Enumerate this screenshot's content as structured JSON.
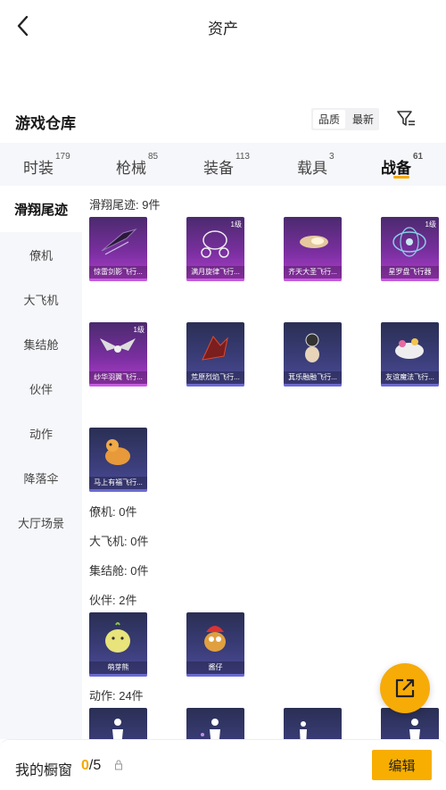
{
  "header": {
    "title": "资产"
  },
  "warehouse": {
    "title": "游戏仓库",
    "sort_options": [
      "品质",
      "最新"
    ],
    "active_sort": "品质"
  },
  "tabs": [
    {
      "label": "时装",
      "count": "179"
    },
    {
      "label": "枪械",
      "count": "85"
    },
    {
      "label": "装备",
      "count": "113"
    },
    {
      "label": "载具",
      "count": "3"
    },
    {
      "label": "战备",
      "count": "61",
      "active": true
    }
  ],
  "sidebar": {
    "items": [
      "滑翔尾迹",
      "僚机",
      "大飞机",
      "集结舱",
      "伙伴",
      "动作",
      "降落伞",
      "大厅场景"
    ],
    "active": "滑翔尾迹"
  },
  "sections": {
    "glide": {
      "label": "滑翔尾迹: 9件",
      "items": [
        {
          "name": "惊雷剑影飞行...",
          "level": "",
          "rarity": "purple"
        },
        {
          "name": "满月旋律飞行...",
          "level": "1级",
          "rarity": "purple"
        },
        {
          "name": "齐天大圣飞行...",
          "level": "",
          "rarity": "purple"
        },
        {
          "name": "星罗盘飞行器",
          "level": "1级",
          "rarity": "purple"
        },
        {
          "name": "纱华羽翼飞行...",
          "level": "1级",
          "rarity": "purple"
        },
        {
          "name": "荒原烈焰飞行...",
          "level": "",
          "rarity": "blue"
        },
        {
          "name": "萁乐融融飞行...",
          "level": "",
          "rarity": "blue"
        },
        {
          "name": "友谊魔法飞行...",
          "level": "",
          "rarity": "blue"
        },
        {
          "name": "马上有福飞行...",
          "level": "",
          "rarity": "blue"
        }
      ]
    },
    "wingman": {
      "label": "僚机: 0件"
    },
    "plane": {
      "label": "大飞机: 0件"
    },
    "pod": {
      "label": "集结舱: 0件"
    },
    "partner": {
      "label": "伙伴: 2件",
      "items": [
        {
          "name": "萌芽熊",
          "rarity": "blue"
        },
        {
          "name": "酱仔",
          "rarity": "blue"
        }
      ]
    },
    "emote": {
      "label": "动作: 24件"
    }
  },
  "bottom": {
    "label": "我的橱窗",
    "current": "0",
    "total": "/5",
    "edit_label": "编辑"
  },
  "colors": {
    "accent": "#f7ab07",
    "purple_rarity": "#b23fcf",
    "blue_rarity": "#4c4b9a"
  },
  "icons": [
    "back-arrow-icon",
    "filter-icon",
    "share-icon",
    "lock-icon"
  ]
}
